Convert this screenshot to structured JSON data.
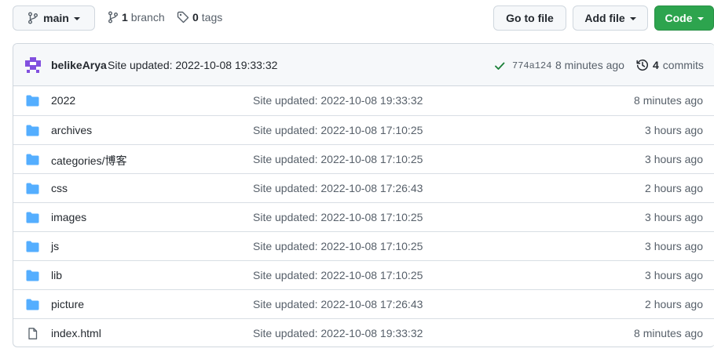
{
  "toolbar": {
    "branch_name": "main",
    "branch_count": "1",
    "branch_label": "branch",
    "tag_count": "0",
    "tag_label": "tags",
    "go_to_file": "Go to file",
    "add_file": "Add file",
    "code": "Code"
  },
  "latest_commit": {
    "author": "belikeArya",
    "message": "Site updated: 2022-10-08 19:33:32",
    "sha": "774a124",
    "age": "8 minutes ago",
    "commit_count": "4",
    "commit_label": "commits"
  },
  "colors": {
    "folder": "#54aeff",
    "code_button": "#2da44e",
    "check": "#1a7f37",
    "avatar": "#8250df"
  },
  "files": [
    {
      "type": "folder",
      "icon": "folder-icon",
      "name": "2022",
      "message": "Site updated: 2022-10-08 19:33:32",
      "age": "8 minutes ago"
    },
    {
      "type": "folder",
      "icon": "folder-icon",
      "name": "archives",
      "message": "Site updated: 2022-10-08 17:10:25",
      "age": "3 hours ago"
    },
    {
      "type": "folder",
      "icon": "folder-icon",
      "name": "categories/博客",
      "message": "Site updated: 2022-10-08 17:10:25",
      "age": "3 hours ago"
    },
    {
      "type": "folder",
      "icon": "folder-icon",
      "name": "css",
      "message": "Site updated: 2022-10-08 17:26:43",
      "age": "2 hours ago"
    },
    {
      "type": "folder",
      "icon": "folder-icon",
      "name": "images",
      "message": "Site updated: 2022-10-08 17:10:25",
      "age": "3 hours ago"
    },
    {
      "type": "folder",
      "icon": "folder-icon",
      "name": "js",
      "message": "Site updated: 2022-10-08 17:10:25",
      "age": "3 hours ago"
    },
    {
      "type": "folder",
      "icon": "folder-icon",
      "name": "lib",
      "message": "Site updated: 2022-10-08 17:10:25",
      "age": "3 hours ago"
    },
    {
      "type": "folder",
      "icon": "folder-icon",
      "name": "picture",
      "message": "Site updated: 2022-10-08 17:26:43",
      "age": "2 hours ago"
    },
    {
      "type": "file",
      "icon": "file-icon",
      "name": "index.html",
      "message": "Site updated: 2022-10-08 19:33:32",
      "age": "8 minutes ago"
    }
  ]
}
